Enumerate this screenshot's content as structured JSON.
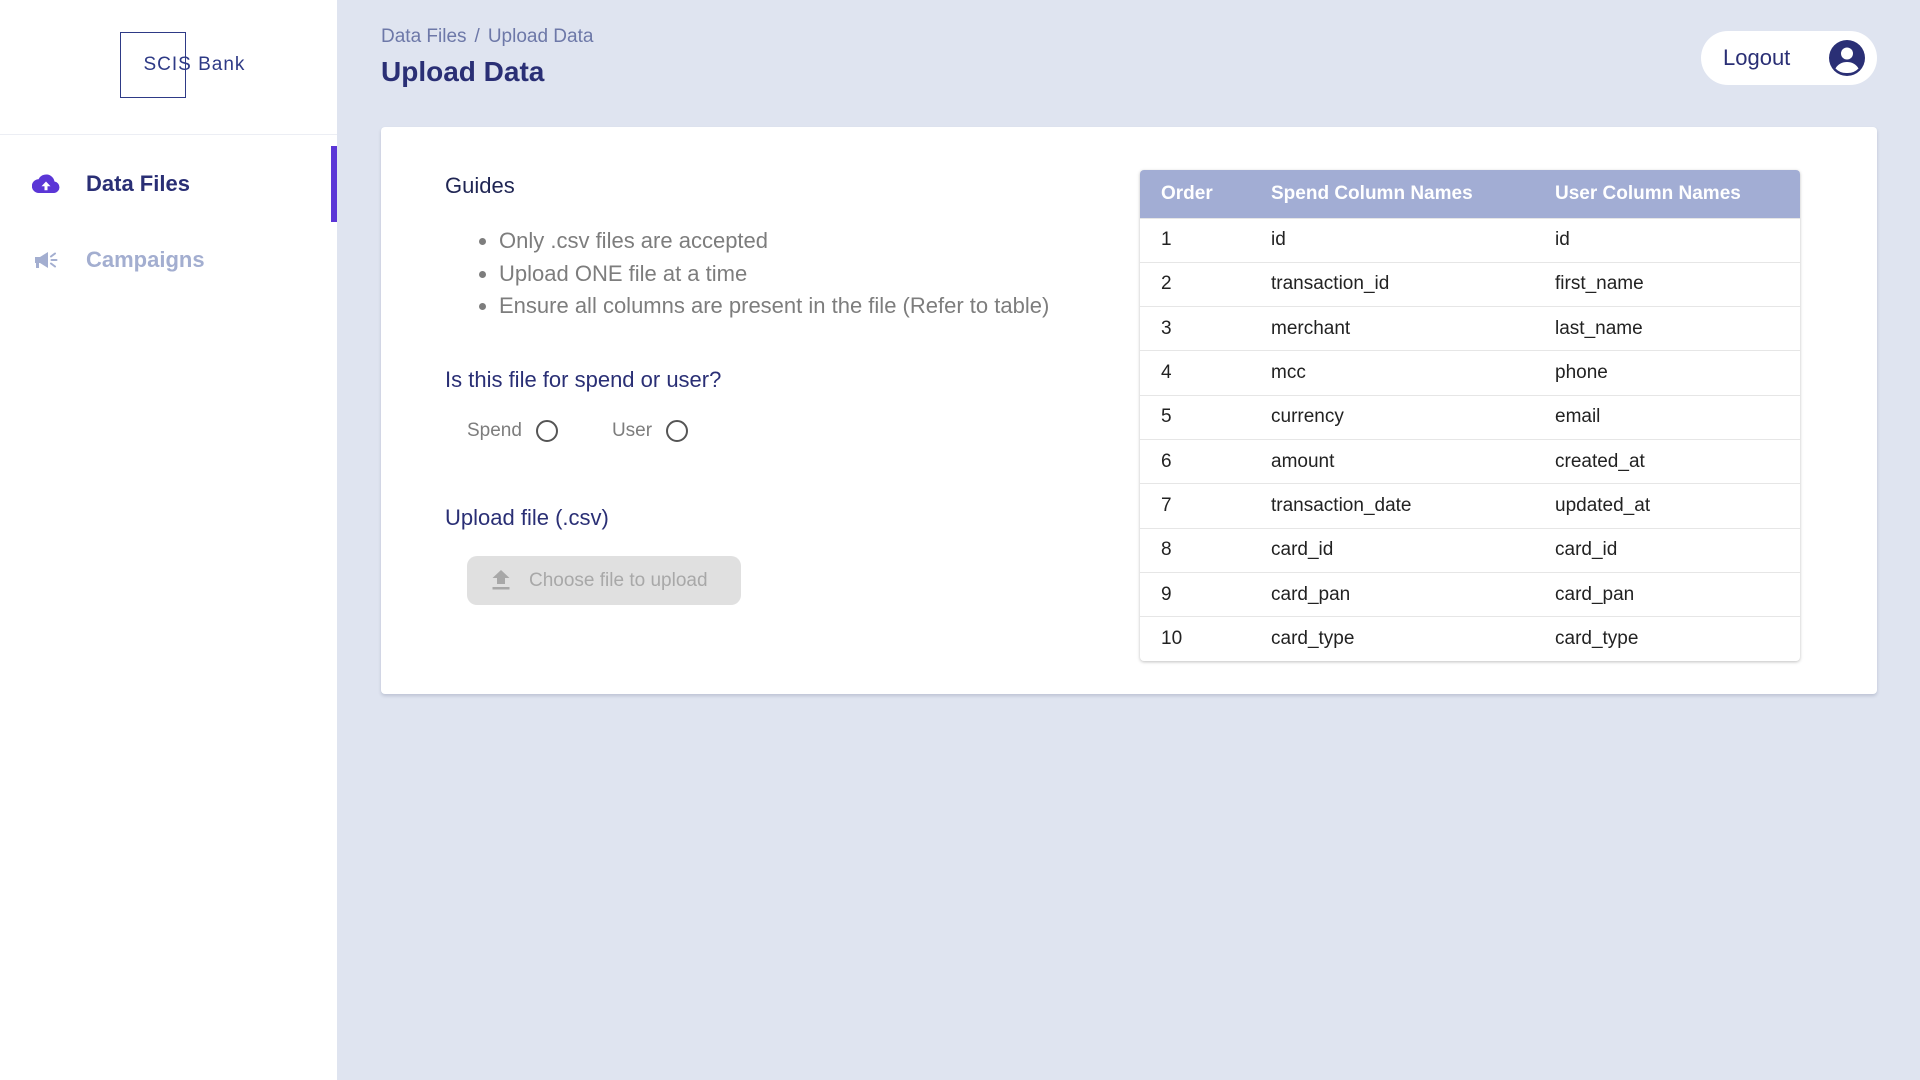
{
  "brand": {
    "name": "SCIS Bank"
  },
  "sidebar": {
    "items": [
      {
        "label": "Data Files",
        "icon": "cloud-upload-icon",
        "active": true
      },
      {
        "label": "Campaigns",
        "icon": "megaphone-icon",
        "active": false
      }
    ]
  },
  "header": {
    "breadcrumb": {
      "parent": "Data Files",
      "separator": "/",
      "current": "Upload Data"
    },
    "title": "Upload Data",
    "logout_label": "Logout"
  },
  "guides": {
    "title": "Guides",
    "items": [
      "Only .csv files are accepted",
      "Upload ONE file at a time",
      "Ensure all columns are present in the file (Refer to table)"
    ]
  },
  "file_type": {
    "question": "Is this file for spend or user?",
    "options": [
      {
        "label": "Spend",
        "selected": false
      },
      {
        "label": "User",
        "selected": false
      }
    ]
  },
  "upload": {
    "label": "Upload file (.csv)",
    "button_label": "Choose file to upload",
    "disabled": true
  },
  "columns_table": {
    "headers": [
      "Order",
      "Spend Column Names",
      "User Column Names"
    ],
    "rows": [
      [
        "1",
        "id",
        "id"
      ],
      [
        "2",
        "transaction_id",
        "first_name"
      ],
      [
        "3",
        "merchant",
        "last_name"
      ],
      [
        "4",
        "mcc",
        "phone"
      ],
      [
        "5",
        "currency",
        "email"
      ],
      [
        "6",
        "amount",
        "created_at"
      ],
      [
        "7",
        "transaction_date",
        "updated_at"
      ],
      [
        "8",
        "card_id",
        "card_id"
      ],
      [
        "9",
        "card_pan",
        "card_pan"
      ],
      [
        "10",
        "card_type",
        "card_type"
      ]
    ]
  },
  "colors": {
    "accent": "#5b36d6",
    "nav_text": "#2a2f75",
    "nav_inactive": "#a3aed0",
    "background": "#dfe4f0",
    "table_header": "#a2add4"
  }
}
